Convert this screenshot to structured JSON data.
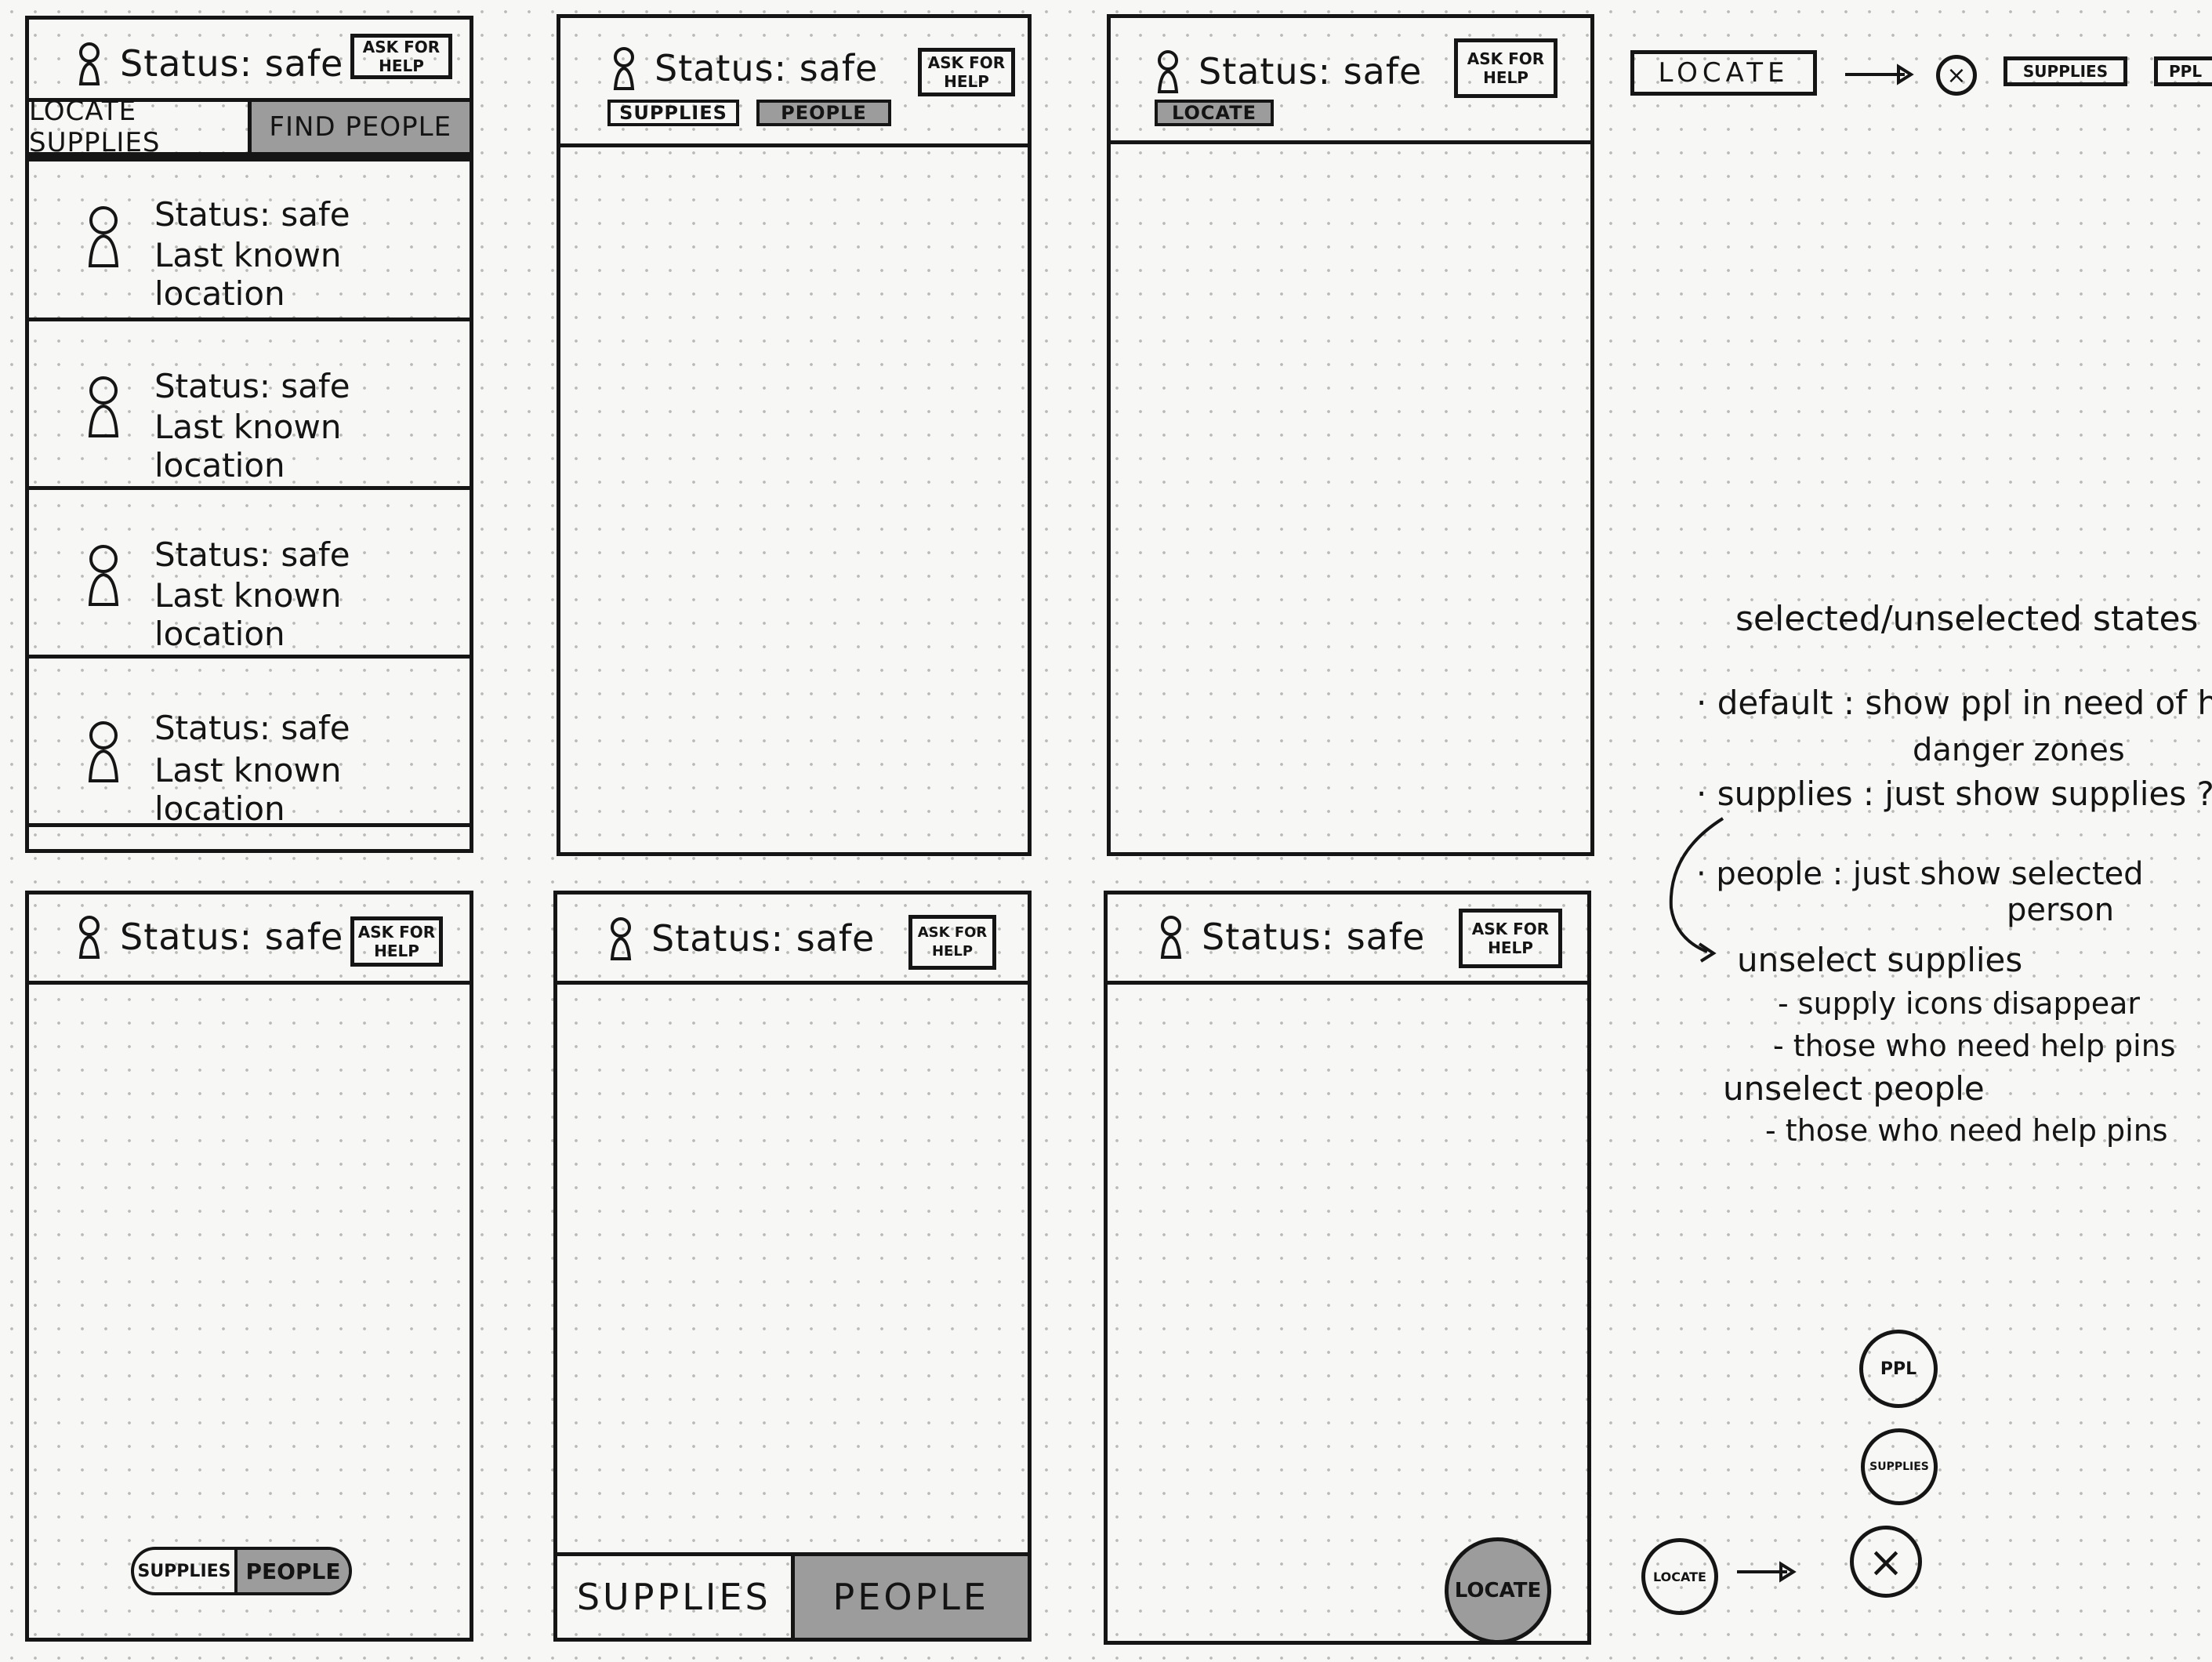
{
  "common": {
    "status_text": "Status: safe",
    "ask_for_help": "ASK FOR HELP"
  },
  "screen1": {
    "tabs": [
      "LOCATE SUPPLIES",
      "FIND PEOPLE"
    ],
    "people": [
      {
        "status": "Status: safe",
        "location": "Last known location"
      },
      {
        "status": "Status: safe",
        "location": "Last known location"
      },
      {
        "status": "Status: safe",
        "location": "Last known location"
      },
      {
        "status": "Status: safe",
        "location": "Last known location"
      }
    ]
  },
  "screen2": {
    "chips": [
      "SUPPLIES",
      "PEOPLE"
    ]
  },
  "screen3": {
    "chip": "LOCATE"
  },
  "screen4": {
    "segments": [
      "SUPPLIES",
      "PEOPLE"
    ]
  },
  "screen5": {
    "bottom_tabs": [
      "SUPPLIES",
      "PEOPLE"
    ]
  },
  "screen6": {
    "fab": "LOCATE"
  },
  "flow_top": {
    "locate": "LOCATE",
    "close_symbol": "×",
    "supplies": "SUPPLIES",
    "ppl": "PPL"
  },
  "notes": {
    "heading": "selected/unselected states",
    "default_line1": "· default : show ppl in need of help",
    "default_line2": "danger zones",
    "supplies": "· supplies : just show supplies ?",
    "people_line1": "· people : just show selected",
    "people_line2": "person",
    "unselect_supplies": "unselect supplies",
    "unselect_supplies_a": "- supply icons disappear",
    "unselect_supplies_b": "- those who need help pins",
    "unselect_people": "unselect people",
    "unselect_people_a": "- those who need help pins"
  },
  "flow_bottom": {
    "ppl": "PPL",
    "supplies": "SUPPLIES",
    "locate": "LOCATE",
    "close_symbol": "×"
  },
  "colors": {
    "ink": "#151515",
    "shade": "#9c9c9c",
    "paper": "#f7f7f5"
  },
  "icons": [
    "person-icon",
    "arrow-right-icon",
    "close-icon"
  ]
}
